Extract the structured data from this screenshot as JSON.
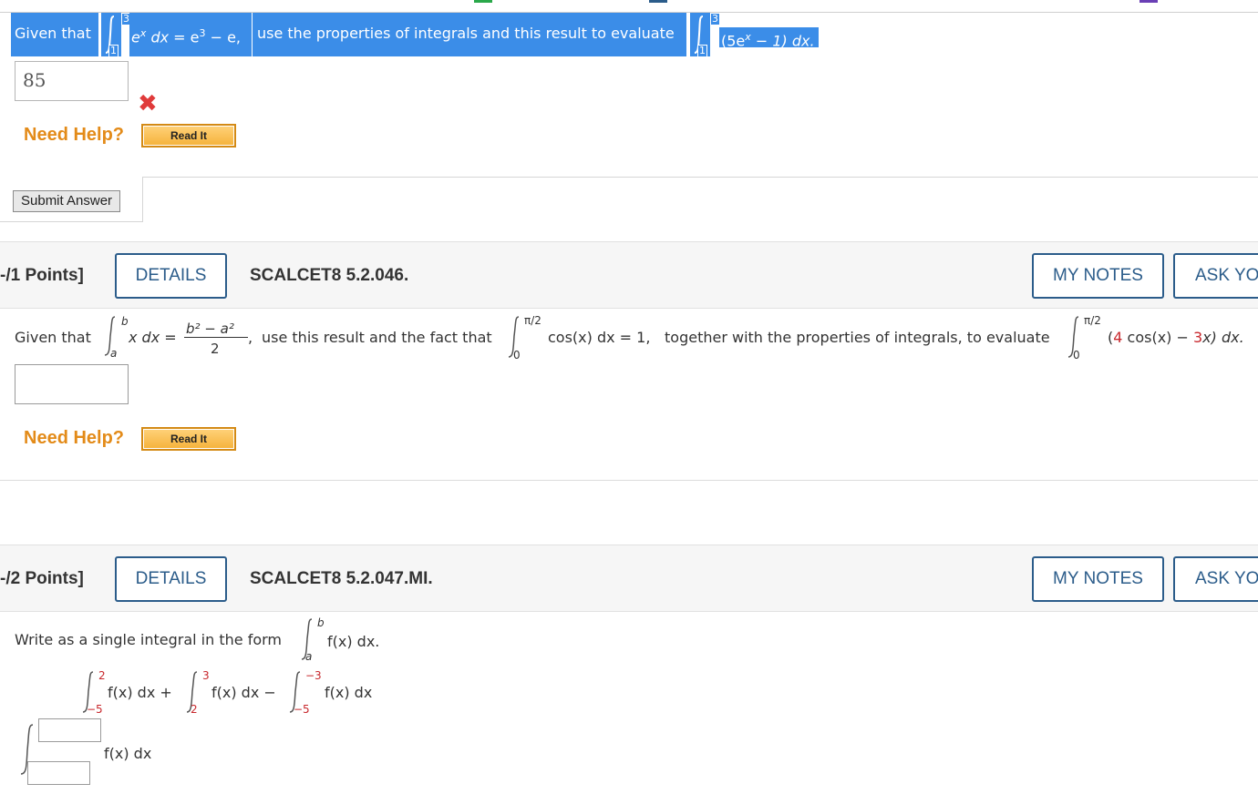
{
  "problem1": {
    "given_label": "Given that",
    "int_lower": "1",
    "int_upper": "3",
    "integrand": "e",
    "integrand_sup": "x",
    "dx": " dx",
    "equals": " = e",
    "rhs_sup": "3",
    "rhs_rest": " − e,",
    "middle_text": "use the properties of integrals and this result to evaluate",
    "eval_lower": "1",
    "eval_upper": "3",
    "eval_integrand": "(5e",
    "eval_sup": "x",
    "eval_rest": " − 1) dx.",
    "answer_value": "85",
    "incorrect_mark": "✖",
    "need_help": "Need Help?",
    "read_it": "Read It",
    "submit": "Submit Answer"
  },
  "problem2": {
    "points": "-/1 Points]",
    "details": "DETAILS",
    "code": "SCALCET8 5.2.046.",
    "my_notes": "MY NOTES",
    "ask": "ASK YO",
    "given_label": "Given that",
    "a": "a",
    "b": "b",
    "x_dx": "x dx =",
    "numerator": "b² − a²",
    "denominator": "2",
    "comma": ",",
    "text1": "use this result and the fact that",
    "lower0": "0",
    "upper_pi2": "π/2",
    "cos_part": "cos(x) dx = 1,",
    "text2": "together with the properties of integrals, to evaluate",
    "eval_open": "(",
    "eval_four": "4",
    "eval_cos": " cos(x) − ",
    "eval_three": "3",
    "eval_end": "x) dx.",
    "need_help": "Need Help?",
    "read_it": "Read It"
  },
  "problem3": {
    "points": "-/2 Points]",
    "details": "DETAILS",
    "code": "SCALCET8 5.2.047.MI.",
    "my_notes": "MY NOTES",
    "ask": "ASK YO",
    "instruction": "Write as a single integral in the form",
    "form_a": "a",
    "form_b": "b",
    "form_fx": "f(x) dx.",
    "t1_lower": "−5",
    "t1_upper": "2",
    "t1_body": "f(x) dx +",
    "t2_lower": "2",
    "t2_upper": "3",
    "t2_body": "f(x) dx −",
    "t3_lower": "−5",
    "t3_upper": "−3",
    "t3_body": "f(x) dx",
    "answer_body": "f(x) dx"
  },
  "colors": {
    "selection": "#3b8de8",
    "accent_blue": "#2b5c8a",
    "help_orange": "#e38b19",
    "error_red": "#e03a3a"
  }
}
